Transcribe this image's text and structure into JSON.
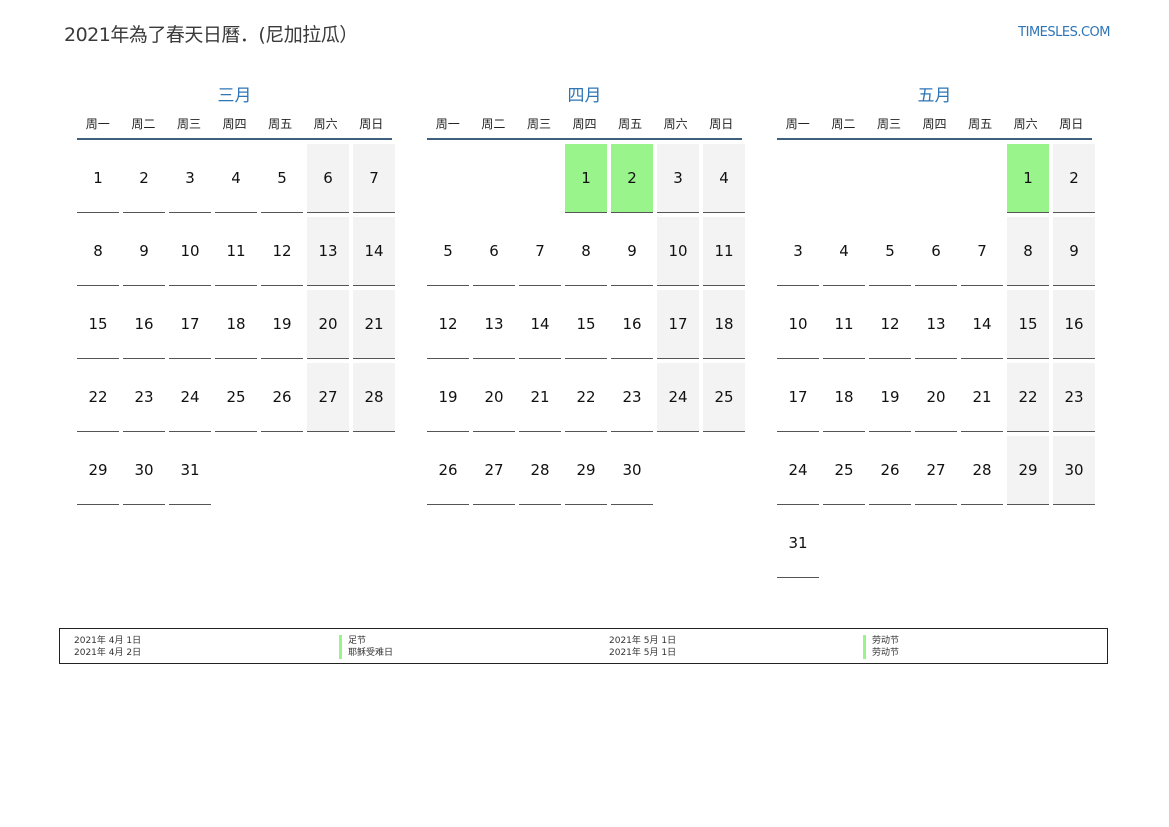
{
  "header": {
    "title": "2021年為了春天日曆．(尼加拉瓜）",
    "brand": "TIMESLES.COM"
  },
  "weekdays": [
    "周一",
    "周二",
    "周三",
    "周四",
    "周五",
    "周六",
    "周日"
  ],
  "months": [
    {
      "name": "三月",
      "offset": 0,
      "days": 31,
      "holidays": []
    },
    {
      "name": "四月",
      "offset": 3,
      "days": 30,
      "holidays": [
        1,
        2
      ]
    },
    {
      "name": "五月",
      "offset": 5,
      "days": 31,
      "holidays": [
        1
      ]
    }
  ],
  "holidays_left": {
    "dates": [
      "2021年 4月 1日",
      "2021年 4月 2日"
    ],
    "names": [
      "足节",
      "耶稣受难日"
    ]
  },
  "holidays_right": {
    "dates": [
      "2021年 5月 1日",
      "2021年 5月 1日"
    ],
    "names": [
      "劳动节",
      "劳动节"
    ]
  },
  "colors": {
    "accent": "#2e75b6",
    "holiday": "#99f48b",
    "weekend": "#f3f3f3"
  }
}
